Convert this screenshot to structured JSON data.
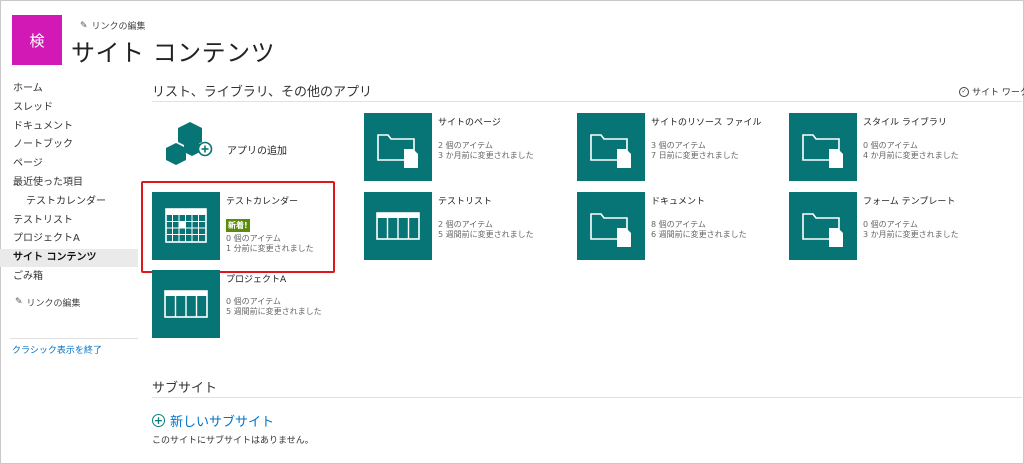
{
  "header": {
    "logo_text": "検",
    "edit_links": "リンクの編集",
    "title": "サイト コンテンツ"
  },
  "left_nav": {
    "items": [
      {
        "label": "ホーム"
      },
      {
        "label": "スレッド"
      },
      {
        "label": "ドキュメント"
      },
      {
        "label": "ノートブック"
      },
      {
        "label": "ページ"
      },
      {
        "label": "最近使った項目"
      },
      {
        "label": "テストカレンダー"
      },
      {
        "label": "テストリスト"
      },
      {
        "label": "プロジェクトA"
      },
      {
        "label": "サイト コンテンツ"
      },
      {
        "label": "ごみ箱"
      }
    ],
    "edit_links": "リンクの編集",
    "exit_classic": "クラシック表示を終了"
  },
  "main": {
    "section_title": "リスト、ライブラリ、その他のアプリ",
    "workflow_link": "サイト ワークフ",
    "add_app": "アプリの追加",
    "tiles": [
      {
        "name": "テストカレンダー",
        "badge": "新着!",
        "count": "0 個のアイテム",
        "modified": "1 分前に変更されました"
      },
      {
        "name": "プロジェクトA",
        "count": "0 個のアイテム",
        "modified": "5 週間前に変更されました"
      },
      {
        "name": "サイトのページ",
        "count": "2 個のアイテム",
        "modified": "3 か月前に変更されました"
      },
      {
        "name": "テストリスト",
        "count": "2 個のアイテム",
        "modified": "5 週間前に変更されました"
      },
      {
        "name": "サイトのリソース ファイル",
        "count": "3 個のアイテム",
        "modified": "7 日前に変更されました"
      },
      {
        "name": "ドキュメント",
        "count": "8 個のアイテム",
        "modified": "6 週間前に変更されました"
      },
      {
        "name": "スタイル ライブラリ",
        "count": "0 個のアイテム",
        "modified": "4 か月前に変更されました"
      },
      {
        "name": "フォーム テンプレート",
        "count": "0 個のアイテム",
        "modified": "3 か月前に変更されました"
      }
    ]
  },
  "subsites": {
    "title": "サブサイト",
    "new_subsite": "新しいサブサイト",
    "empty_message": "このサイトにサブサイトはありません。"
  },
  "colors": {
    "tile_teal": "#077575",
    "logo_magenta": "#d319b5",
    "link_blue": "#0072c6",
    "new_badge_green": "#5a8b0b",
    "highlight_red": "#e0161e"
  },
  "icons": [
    "pencil-icon",
    "calendar-icon",
    "list-icon",
    "folder-document-icon",
    "app-cubes-icon",
    "plus-circle-icon",
    "checkmark-circle-icon"
  ]
}
